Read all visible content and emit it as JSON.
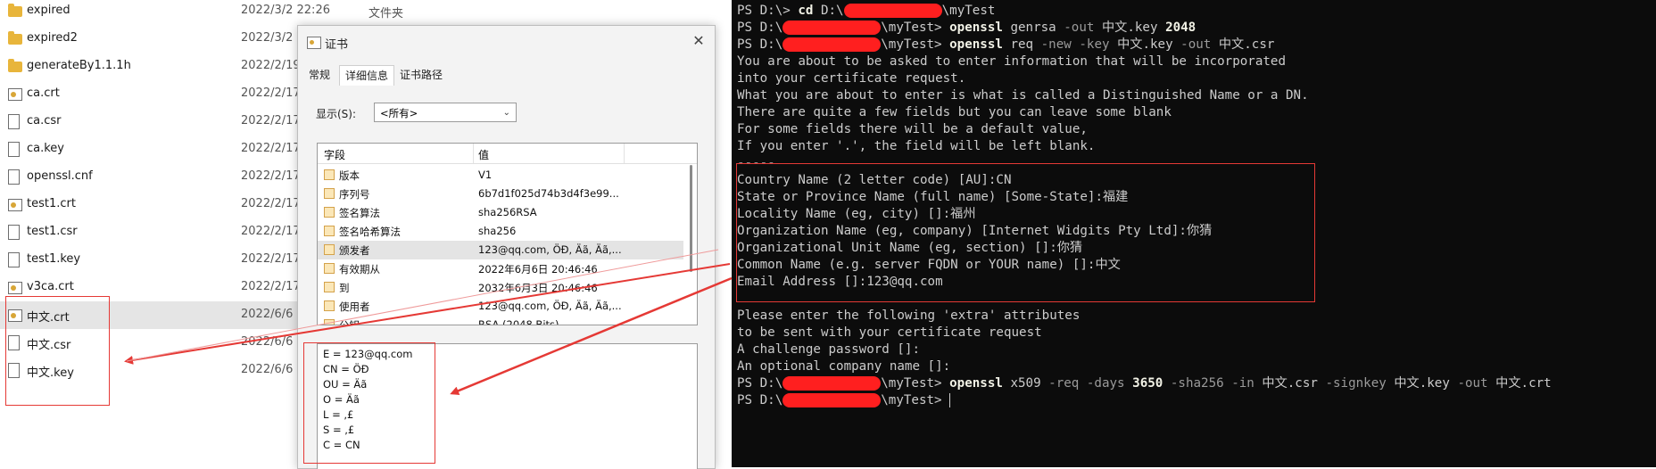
{
  "explorer": {
    "files": [
      {
        "name": "expired",
        "date": "2022/3/2 22:26",
        "type": "文件夹",
        "icon": "folder-icon",
        "selected": false
      },
      {
        "name": "expired2",
        "date": "2022/3/2",
        "type": "",
        "icon": "folder-icon",
        "selected": false
      },
      {
        "name": "generateBy1.1.1h",
        "date": "2022/2/19",
        "type": "",
        "icon": "folder-icon",
        "selected": false
      },
      {
        "name": "ca.crt",
        "date": "2022/2/17",
        "type": "",
        "icon": "certificate-icon",
        "selected": false
      },
      {
        "name": "ca.csr",
        "date": "2022/2/17",
        "type": "",
        "icon": "document-icon",
        "selected": false
      },
      {
        "name": "ca.key",
        "date": "2022/2/17",
        "type": "",
        "icon": "document-icon",
        "selected": false
      },
      {
        "name": "openssl.cnf",
        "date": "2022/2/17",
        "type": "",
        "icon": "document-icon",
        "selected": false
      },
      {
        "name": "test1.crt",
        "date": "2022/2/17",
        "type": "",
        "icon": "certificate-icon",
        "selected": false
      },
      {
        "name": "test1.csr",
        "date": "2022/2/17",
        "type": "",
        "icon": "document-icon",
        "selected": false
      },
      {
        "name": "test1.key",
        "date": "2022/2/17",
        "type": "",
        "icon": "document-icon",
        "selected": false
      },
      {
        "name": "v3ca.crt",
        "date": "2022/2/17",
        "type": "",
        "icon": "certificate-icon",
        "selected": false
      },
      {
        "name": "中文.crt",
        "date": "2022/6/6 2",
        "type": "",
        "icon": "certificate-icon",
        "selected": true
      },
      {
        "name": "中文.csr",
        "date": "2022/6/6 2",
        "type": "",
        "icon": "document-icon",
        "selected": false
      },
      {
        "name": "中文.key",
        "date": "2022/6/6 2",
        "type": "",
        "icon": "document-icon",
        "selected": false
      }
    ]
  },
  "dialog": {
    "title": "证书",
    "close_glyph": "✕",
    "tabs": [
      {
        "label": "常规",
        "active": false
      },
      {
        "label": "详细信息",
        "active": true
      },
      {
        "label": "证书路径",
        "active": false
      }
    ],
    "show_label": "显示(S):",
    "show_value": "<所有>",
    "columns": [
      "字段",
      "值"
    ],
    "fields": [
      {
        "name": "版本",
        "value": "V1"
      },
      {
        "name": "序列号",
        "value": "6b7d1f025d74b3d4f3e99..."
      },
      {
        "name": "签名算法",
        "value": "sha256RSA"
      },
      {
        "name": "签名哈希算法",
        "value": "sha256"
      },
      {
        "name": "颁发者",
        "value": "123@qq.com, ÖÐ, Äã, Äã,..."
      },
      {
        "name": "有效期从",
        "value": "2022年6月6日 20:46:46"
      },
      {
        "name": "到",
        "value": "2032年6月3日 20:46:46"
      },
      {
        "name": "使用者",
        "value": "123@qq.com, ÖÐ, Äã, Äã,..."
      },
      {
        "name": "公钥",
        "value": "RSA (2048 Bits)"
      }
    ],
    "detail_lines": [
      "E = 123@qq.com",
      "CN = ÖÐ",
      "OU = Äã",
      "O = Äã",
      "L = ,£",
      "S = ,£",
      "C = CN"
    ]
  },
  "terminal": {
    "lines": [
      [
        {
          "t": "PS D:\\> "
        },
        {
          "t": "cd",
          "c": "cmd"
        },
        {
          "t": " D:\\"
        },
        {
          "r": true
        },
        {
          "t": "\\myTest"
        }
      ],
      [
        {
          "t": "PS D:\\"
        },
        {
          "r": true
        },
        {
          "t": "\\myTest> "
        },
        {
          "t": "openssl",
          "c": "cmd"
        },
        {
          "t": " genrsa "
        },
        {
          "t": "-out",
          "c": "flag"
        },
        {
          "t": " 中文.key "
        },
        {
          "t": "2048",
          "c": "num"
        }
      ],
      [
        {
          "t": "PS D:\\"
        },
        {
          "r": true
        },
        {
          "t": "\\myTest> "
        },
        {
          "t": "openssl",
          "c": "cmd"
        },
        {
          "t": " req "
        },
        {
          "t": "-new",
          "c": "flag"
        },
        {
          "t": " "
        },
        {
          "t": "-key",
          "c": "flag"
        },
        {
          "t": " 中文.key "
        },
        {
          "t": "-out",
          "c": "flag"
        },
        {
          "t": " 中文.csr"
        }
      ],
      [
        {
          "t": "You are about to be asked to enter information that will be incorporated"
        }
      ],
      [
        {
          "t": "into your certificate request."
        }
      ],
      [
        {
          "t": "What you are about to enter is what is called a Distinguished Name or a DN."
        }
      ],
      [
        {
          "t": "There are quite a few fields but you can leave some blank"
        }
      ],
      [
        {
          "t": "For some fields there will be a default value,"
        }
      ],
      [
        {
          "t": "If you enter '.', the field will be left blank."
        }
      ],
      [
        {
          "t": "-----"
        }
      ],
      [
        {
          "t": "Country Name (2 letter code) [AU]:CN"
        }
      ],
      [
        {
          "t": "State or Province Name (full name) [Some-State]:福建"
        }
      ],
      [
        {
          "t": "Locality Name (eg, city) []:福州"
        }
      ],
      [
        {
          "t": "Organization Name (eg, company) [Internet Widgits Pty Ltd]:你猜"
        }
      ],
      [
        {
          "t": "Organizational Unit Name (eg, section) []:你猜"
        }
      ],
      [
        {
          "t": "Common Name (e.g. server FQDN or YOUR name) []:中文"
        }
      ],
      [
        {
          "t": "Email Address []:123@qq.com"
        }
      ],
      [
        {
          "t": ""
        }
      ],
      [
        {
          "t": "Please enter the following 'extra' attributes"
        }
      ],
      [
        {
          "t": "to be sent with your certificate request"
        }
      ],
      [
        {
          "t": "A challenge password []:"
        }
      ],
      [
        {
          "t": "An optional company name []:"
        }
      ],
      [
        {
          "t": "PS D:\\"
        },
        {
          "r": true
        },
        {
          "t": "\\myTest> "
        },
        {
          "t": "openssl",
          "c": "cmd"
        },
        {
          "t": " x509 "
        },
        {
          "t": "-req",
          "c": "flag"
        },
        {
          "t": " "
        },
        {
          "t": "-days",
          "c": "flag"
        },
        {
          "t": " "
        },
        {
          "t": "3650",
          "c": "num"
        },
        {
          "t": " "
        },
        {
          "t": "-sha256",
          "c": "flag"
        },
        {
          "t": " "
        },
        {
          "t": "-in",
          "c": "flag"
        },
        {
          "t": " 中文.csr "
        },
        {
          "t": "-signkey",
          "c": "flag"
        },
        {
          "t": " 中文.key "
        },
        {
          "t": "-out",
          "c": "flag"
        },
        {
          "t": " 中文.crt"
        }
      ],
      [
        {
          "t": "PS D:\\"
        },
        {
          "r": true
        },
        {
          "t": "\\myTest> "
        },
        {
          "cursor": true
        }
      ]
    ]
  },
  "colors": {
    "annotation": "#e53935",
    "redaction": "#ff1f1f",
    "terminal_bg": "#0c0c0c",
    "terminal_fg": "#cccccc"
  }
}
